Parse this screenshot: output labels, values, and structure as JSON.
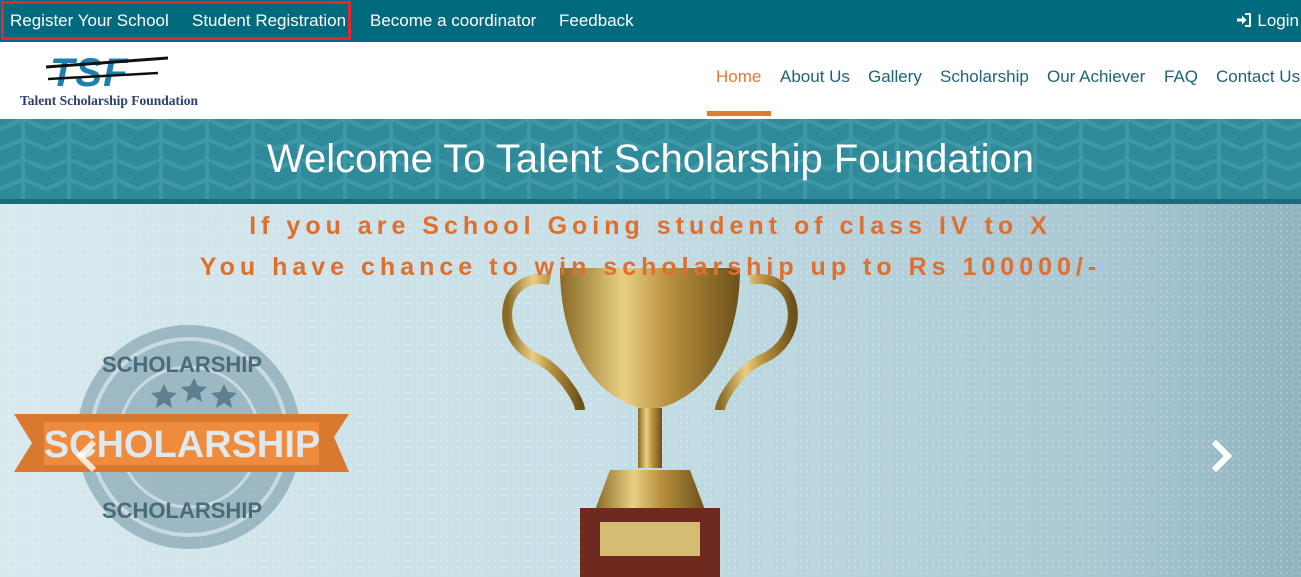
{
  "topbar": {
    "links": [
      "Register Your School",
      "Student Registration",
      "Become a coordinator",
      "Feedback"
    ],
    "login": "Login"
  },
  "logo": {
    "mark": "TSF",
    "subtitle": "Talent Scholarship Foundation"
  },
  "nav": {
    "items": [
      "Home",
      "About Us",
      "Gallery",
      "Scholarship",
      "Our Achiever",
      "FAQ",
      "Contact Us"
    ],
    "active": "Home"
  },
  "welcome": {
    "title": "Welcome To Talent Scholarship Foundation"
  },
  "hero": {
    "line1": "If you are School Going student of class IV to X",
    "line2": "You have chance to win scholarship up to Rs 100000/-",
    "badge_words": [
      "SCHOLARSHIP",
      "SCHOLARSHIP",
      "SCHOLARSHIP"
    ]
  },
  "colors": {
    "topbar": "#006a7f",
    "accent": "#e07a34",
    "nav_text": "#1c6478",
    "highlight_box": "#e0262e"
  },
  "icons": {
    "login": "sign-in-icon",
    "prev": "chevron-left-icon",
    "next": "chevron-right-icon"
  }
}
